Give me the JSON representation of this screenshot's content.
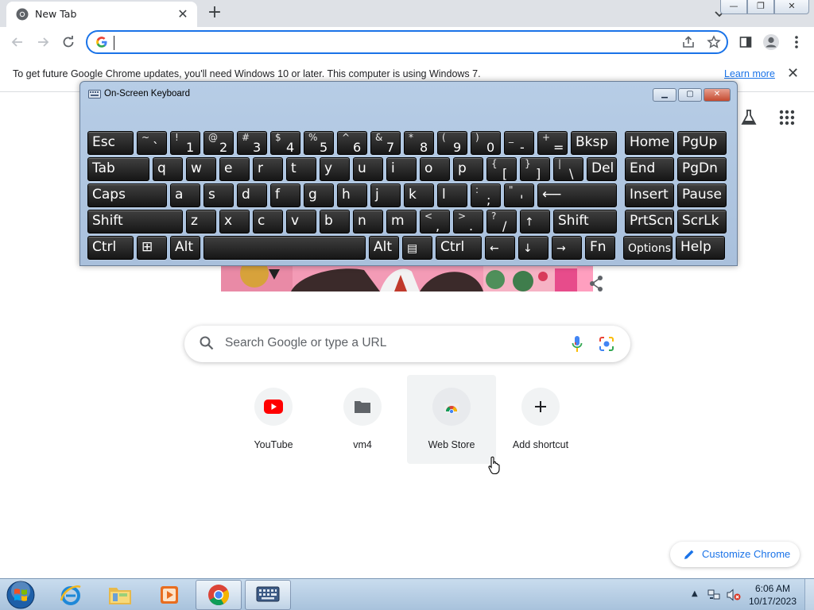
{
  "browser": {
    "tab_title": "New Tab",
    "new_tab_symbol": "+",
    "tab_close_symbol": "✕",
    "win_minimize": "—",
    "win_restore": "❐",
    "win_close": "✕",
    "omnibox_value": "",
    "accent": "#1a73e8"
  },
  "infobar": {
    "message": "To get future Google Chrome updates, you'll need Windows 10 or later. This computer is using Windows 7.",
    "link": "Learn more",
    "close_symbol": "✕"
  },
  "ntp": {
    "search_placeholder": "Search Google or type a URL",
    "shortcuts": [
      {
        "label": "YouTube",
        "icon": "youtube-icon"
      },
      {
        "label": "vm4",
        "icon": "folder-icon"
      },
      {
        "label": "Web Store",
        "icon": "web-store-icon"
      },
      {
        "label": "Add shortcut",
        "icon": "plus-icon"
      }
    ],
    "customize_label": "Customize Chrome"
  },
  "osk": {
    "title": "On-Screen Keyboard",
    "rows": [
      [
        {
          "m": "Esc",
          "w": 60
        },
        {
          "a": "~",
          "s": "`",
          "w": 40
        },
        {
          "a": "!",
          "s": "1",
          "w": 40
        },
        {
          "a": "@",
          "s": "2",
          "w": 40
        },
        {
          "a": "#",
          "s": "3",
          "w": 40
        },
        {
          "a": "$",
          "s": "4",
          "w": 40
        },
        {
          "a": "%",
          "s": "5",
          "w": 40
        },
        {
          "a": "^",
          "s": "6",
          "w": 40
        },
        {
          "a": "&",
          "s": "7",
          "w": 40
        },
        {
          "a": "*",
          "s": "8",
          "w": 40
        },
        {
          "a": "(",
          "s": "9",
          "w": 40
        },
        {
          "a": ")",
          "s": "0",
          "w": 40
        },
        {
          "a": "_",
          "s": "-",
          "w": 40
        },
        {
          "a": "+",
          "s": "=",
          "w": 40
        },
        {
          "m": "Bksp",
          "w": 60
        },
        {
          "m": "Home",
          "w": 64,
          "gap": 6
        },
        {
          "m": "PgUp",
          "w": 64
        }
      ],
      [
        {
          "m": "Tab",
          "w": 80
        },
        {
          "m": "q",
          "w": 40
        },
        {
          "m": "w",
          "w": 40
        },
        {
          "m": "e",
          "w": 40
        },
        {
          "m": "r",
          "w": 40
        },
        {
          "m": "t",
          "w": 40
        },
        {
          "m": "y",
          "w": 40
        },
        {
          "m": "u",
          "w": 40
        },
        {
          "m": "i",
          "w": 40
        },
        {
          "m": "o",
          "w": 40
        },
        {
          "m": "p",
          "w": 40
        },
        {
          "a": "{",
          "s": "[",
          "w": 40
        },
        {
          "a": "}",
          "s": "]",
          "w": 40
        },
        {
          "a": "|",
          "s": "\\",
          "w": 40
        },
        {
          "m": "Del",
          "w": 40
        },
        {
          "m": "End",
          "w": 64,
          "gap": 6
        },
        {
          "m": "PgDn",
          "w": 64
        }
      ],
      [
        {
          "m": "Caps",
          "w": 102
        },
        {
          "m": "a",
          "w": 40
        },
        {
          "m": "s",
          "w": 40
        },
        {
          "m": "d",
          "w": 40
        },
        {
          "m": "f",
          "w": 40
        },
        {
          "m": "g",
          "w": 40
        },
        {
          "m": "h",
          "w": 40
        },
        {
          "m": "j",
          "w": 40
        },
        {
          "m": "k",
          "w": 40
        },
        {
          "m": "l",
          "w": 40
        },
        {
          "a": ":",
          "s": ";",
          "w": 40
        },
        {
          "a": "\"",
          "s": "'",
          "w": 40
        },
        {
          "m": "⟵",
          "w": 102
        },
        {
          "m": "Insert",
          "w": 64,
          "gap": 6
        },
        {
          "m": "Pause",
          "w": 64
        }
      ],
      [
        {
          "m": "Shift",
          "w": 122
        },
        {
          "m": "z",
          "w": 40
        },
        {
          "m": "x",
          "w": 40
        },
        {
          "m": "c",
          "w": 40
        },
        {
          "m": "v",
          "w": 40
        },
        {
          "m": "b",
          "w": 40
        },
        {
          "m": "n",
          "w": 40
        },
        {
          "m": "m",
          "w": 40
        },
        {
          "a": "<",
          "s": ",",
          "w": 40
        },
        {
          "a": ">",
          "s": ".",
          "w": 40
        },
        {
          "a": "?",
          "s": "/",
          "w": 40
        },
        {
          "m": "↑",
          "w": 40,
          "small": true
        },
        {
          "m": "Shift",
          "w": 82
        },
        {
          "m": "PrtScn",
          "w": 64,
          "gap": 6
        },
        {
          "m": "ScrLk",
          "w": 64
        }
      ],
      [
        {
          "m": "Ctrl",
          "w": 60
        },
        {
          "m": "⊞",
          "w": 40
        },
        {
          "m": "Alt",
          "w": 40
        },
        {
          "m": "",
          "w": 206
        },
        {
          "m": "Alt",
          "w": 40
        },
        {
          "m": "▤",
          "w": 40,
          "small": true
        },
        {
          "m": "Ctrl",
          "w": 60
        },
        {
          "m": "←",
          "w": 40,
          "small": true
        },
        {
          "m": "↓",
          "w": 40,
          "small": true
        },
        {
          "m": "→",
          "w": 40,
          "small": true
        },
        {
          "m": "Fn",
          "w": 40
        },
        {
          "m": "Options",
          "w": 64,
          "gap": 6,
          "small": true
        },
        {
          "m": "Help",
          "w": 64
        }
      ]
    ]
  },
  "taskbar": {
    "clock_time": "6:06 AM",
    "clock_date": "10/17/2023",
    "tray_arrow": "▲",
    "color": "#b9cfe6"
  }
}
